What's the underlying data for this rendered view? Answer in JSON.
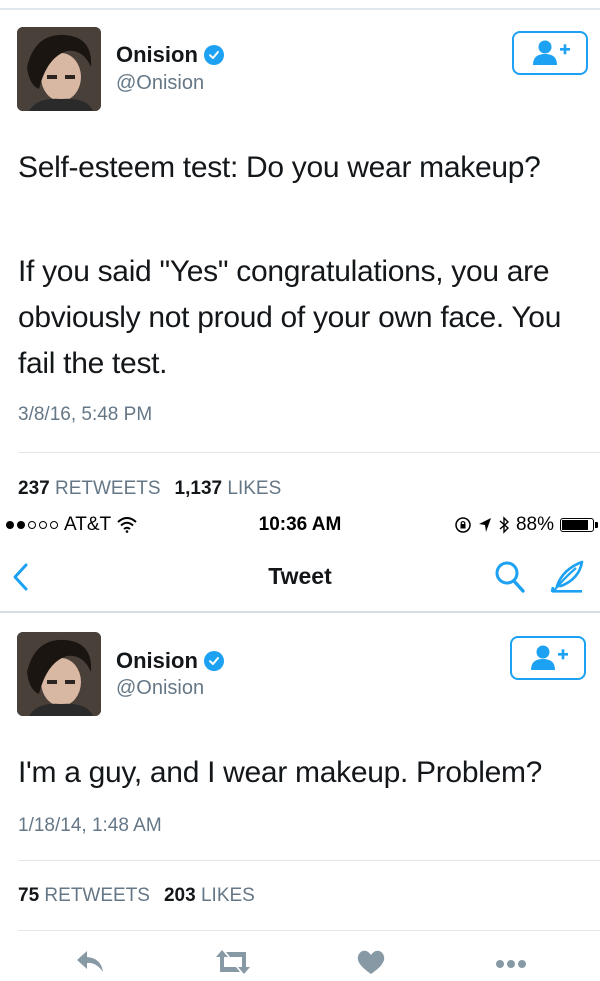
{
  "tweet1": {
    "author_name": "Onision",
    "handle": "@Onision",
    "paragraphs": [
      "Self-esteem test: Do you wear makeup?",
      "If you said \"Yes\" congratulations, you are obviously not proud of your own face. You fail the test."
    ],
    "timestamp": "3/8/16, 5:48 PM",
    "retweets_count": "237",
    "retweets_label": "RETWEETS",
    "likes_count": "1,137",
    "likes_label": "LIKES"
  },
  "status_bar": {
    "carrier": "AT&T",
    "time": "10:36 AM",
    "battery": "88%"
  },
  "nav": {
    "title": "Tweet"
  },
  "tweet2": {
    "author_name": "Onision",
    "handle": "@Onision",
    "text": "I'm a guy, and I wear makeup. Problem?",
    "timestamp": "1/18/14, 1:48 AM",
    "retweets_count": "75",
    "retweets_label": "RETWEETS",
    "likes_count": "203",
    "likes_label": "LIKES"
  },
  "icons": {
    "verified": "verified-badge-icon",
    "follow": "add-user-icon",
    "back": "chevron-left-icon",
    "search": "search-icon",
    "compose": "compose-feather-icon",
    "reply": "reply-icon",
    "retweet": "retweet-icon",
    "like": "heart-icon",
    "more": "more-dots-icon"
  },
  "colors": {
    "accent": "#1da1f2",
    "text": "#14171a",
    "muted": "#657786",
    "action_icons": "#8899a6"
  }
}
